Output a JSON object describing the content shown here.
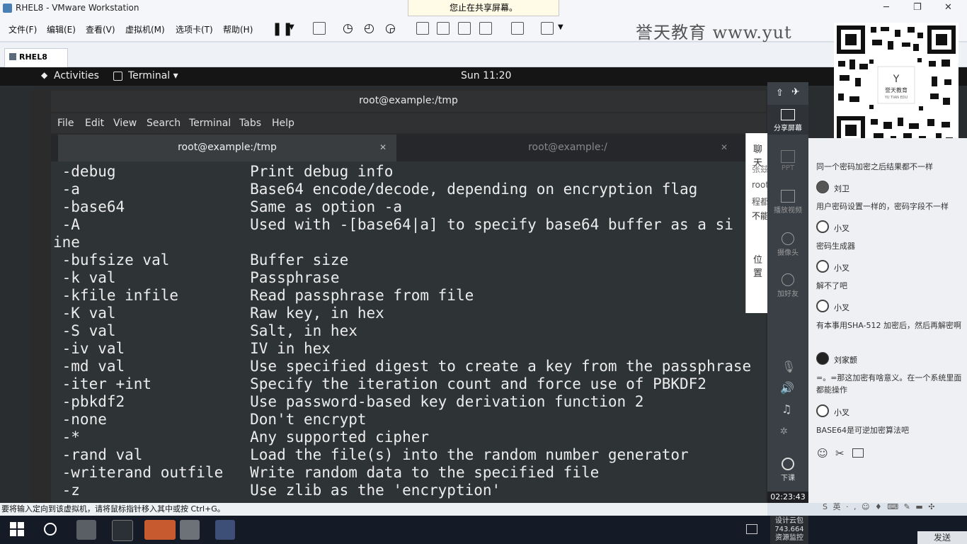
{
  "vmware": {
    "window_title": "RHEL8 - VMware Workstation",
    "share_banner": "您止在共享屏幕。",
    "menus": [
      "文件(F)",
      "编辑(E)",
      "查看(V)",
      "虚拟机(M)",
      "选项卡(T)",
      "帮助(H)"
    ],
    "tab_label": "RHEL8",
    "watermark": "誉天教育 www.yut",
    "status_hint": "要将输入定向到该虚拟机，请将鼠标指针移入其中或按 Ctrl+G。"
  },
  "gnome": {
    "activities": "Activities",
    "app_menu": "Terminal ▾",
    "clock": "Sun 11:20"
  },
  "terminal": {
    "window_title": "root@example:/tmp",
    "menus": [
      "File",
      "Edit",
      "View",
      "Search",
      "Terminal",
      "Tabs",
      "Help"
    ],
    "tabs": [
      {
        "label": "root@example:/tmp",
        "active": true
      },
      {
        "label": "root@example:/",
        "active": false
      }
    ],
    "lines": [
      " -debug               Print debug info",
      " -a                   Base64 encode/decode, depending on encryption flag",
      " -base64              Same as option -a",
      " -A                   Used with -[base64|a] to specify base64 buffer as a si",
      "ine",
      " -bufsize val         Buffer size",
      " -k val               Passphrase",
      " -kfile infile        Read passphrase from file",
      " -K val               Raw key, in hex",
      " -S val               Salt, in hex",
      " -iv val              IV in hex",
      " -md val              Use specified digest to create a key from the passphrase",
      " -iter +int           Specify the iteration count and force use of PBKDF2",
      " -pbkdf2              Use password-based key derivation function 2",
      " -none                Don't encrypt",
      " -*                   Any supported cipher",
      " -rand val            Load the file(s) into the random number generator",
      " -writerand outfile   Write random data to the specified file",
      " -z                   Use zlib as the 'encryption'"
    ]
  },
  "chat_popup": {
    "title": "聊天",
    "lines": [
      "张兹",
      "root",
      "程都",
      "不能",
      "位置"
    ]
  },
  "share_toolbar": {
    "share_label": "分享屏幕",
    "items": [
      "PPT",
      "播放视频",
      "摄像头",
      "加好友",
      "下课"
    ],
    "timer": "02:23:43",
    "stats_1": "设计云包",
    "stats_2": "743.664",
    "stats_3": "资源监控"
  },
  "qr": {
    "center_text": "誉天教育",
    "center_sub": "YU TIAN EDU"
  },
  "chat": {
    "messages": [
      {
        "name": "",
        "text": "同一个密码加密之后结果都不一样"
      },
      {
        "name": "刘卫",
        "text": "用户密码设置一样的，密码字段不一样"
      },
      {
        "name": "小叉",
        "text": "密码生成器"
      },
      {
        "name": "小叉",
        "text": "解不了吧"
      },
      {
        "name": "小叉",
        "text": "有本事用SHA-512 加密后，然后再解密啊"
      },
      {
        "name": "刘家颤",
        "text": "=。=那这加密有啥意义。在一个系统里面都能操作"
      },
      {
        "name": "小叉",
        "text": "BASE64是可逆加密算法吧"
      }
    ],
    "send_label": "发送",
    "input_icons": "S 英 · , ☺ ♦ ⌨ ✎ ▬ ✣"
  }
}
